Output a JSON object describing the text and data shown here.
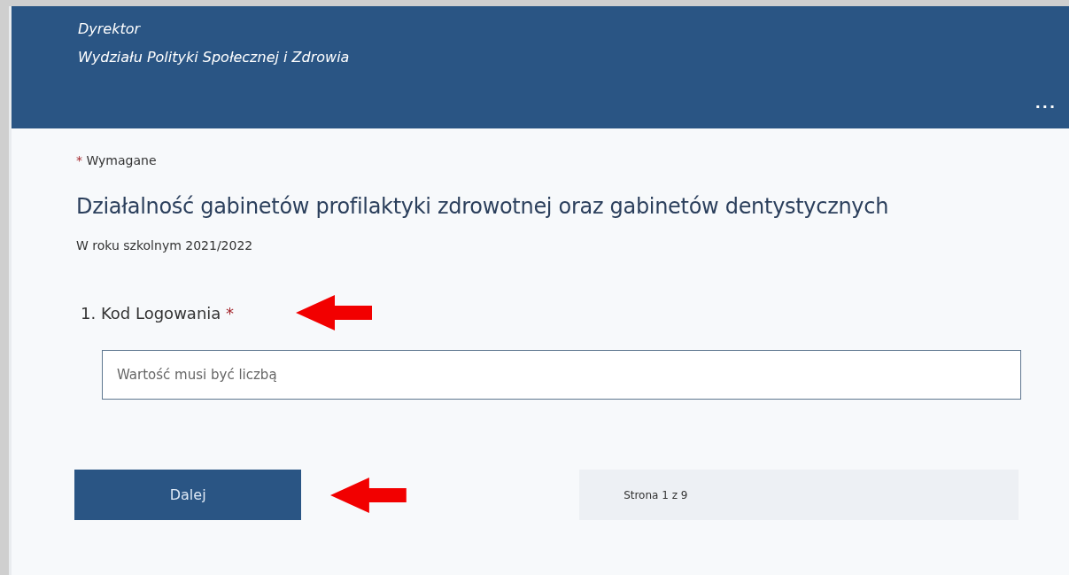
{
  "header": {
    "lines": [
      "Dyrektor",
      "Wydziału Polityki Społecznej i Zdrowia"
    ],
    "more": "..."
  },
  "required_note": {
    "mark": "*",
    "text": "Wymagane"
  },
  "form": {
    "title": "Działalność gabinetów profilaktyki zdrowotnej oraz gabinetów dentystycznych",
    "subtitle": "W roku szkolnym 2021/2022"
  },
  "questions": [
    {
      "number": "1.",
      "label": "Kod Logowania",
      "required_mark": "*",
      "placeholder": "Wartość musi być liczbą"
    }
  ],
  "footer": {
    "next_button": "Dalej",
    "page_indicator": "Strona 1 z 9"
  }
}
